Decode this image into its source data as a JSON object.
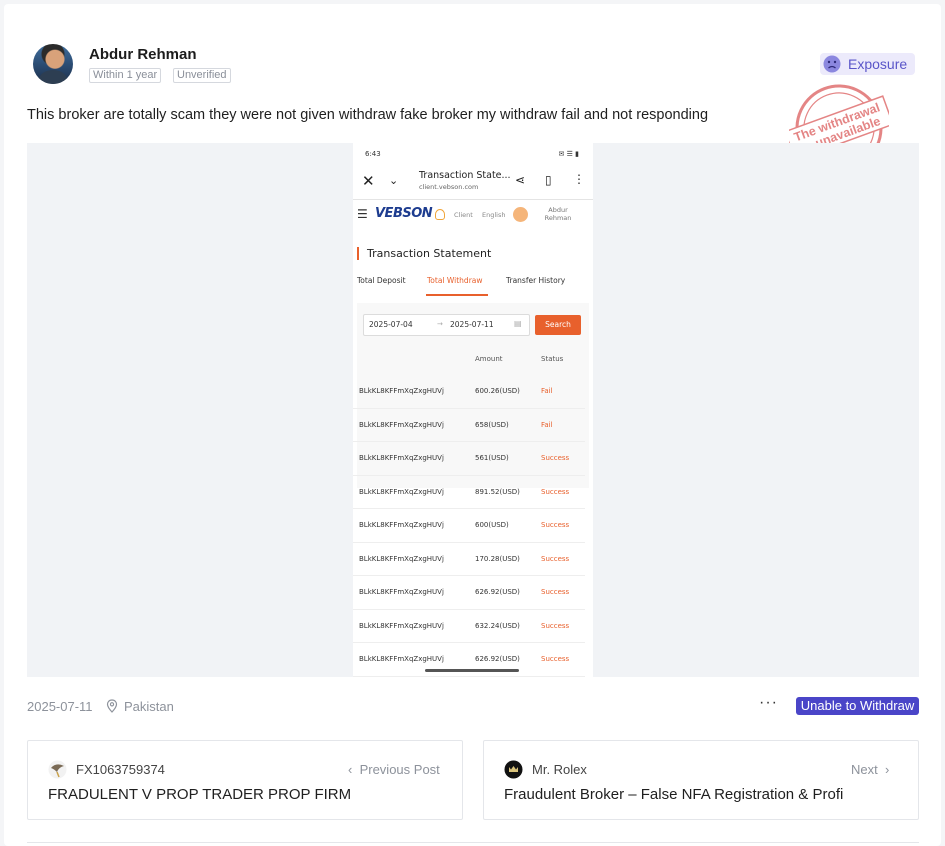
{
  "author": {
    "name": "Abdur Rehman",
    "tags": [
      "Within 1 year",
      "Unverified"
    ]
  },
  "category": {
    "label": "Exposure",
    "icon": "sad-face-icon",
    "color": "#5a56c9"
  },
  "stamp": {
    "line1": "The withdrawal",
    "line2": "is unavailable",
    "color": "#e07070"
  },
  "post": {
    "text": "This broker are totally scam they were not given withdraw fake broker my withdraw fail and not responding"
  },
  "screenshot": {
    "status_time": "6:43",
    "status_right": "✉ ☰ ▮",
    "page_title": "Transaction State...",
    "url": "client.vebson.com",
    "logo": "VEBSON",
    "nav_client": "Client",
    "nav_lang": "English",
    "nav_user_line1": "Abdur",
    "nav_user_line2": "Rehman",
    "section_title": "Transaction Statement",
    "tabs": [
      "Total Deposit",
      "Total Withdraw",
      "Transfer History"
    ],
    "active_tab": "Total Withdraw",
    "date_from": "2025-07-04",
    "date_arrow": "→",
    "date_to": "2025-07-11",
    "search_label": "Search",
    "columns": [
      "Amount",
      "Status"
    ],
    "rows": [
      {
        "id": "BLkKL8KFFmXqZxgHUVj",
        "amount": "600.26(USD)",
        "status": "Fail"
      },
      {
        "id": "BLkKL8KFFmXqZxgHUVj",
        "amount": "658(USD)",
        "status": "Fail"
      },
      {
        "id": "BLkKL8KFFmXqZxgHUVj",
        "amount": "561(USD)",
        "status": "Success"
      },
      {
        "id": "BLkKL8KFFmXqZxgHUVj",
        "amount": "891.52(USD)",
        "status": "Success"
      },
      {
        "id": "BLkKL8KFFmXqZxgHUVj",
        "amount": "600(USD)",
        "status": "Success"
      },
      {
        "id": "BLkKL8KFFmXqZxgHUVj",
        "amount": "170.28(USD)",
        "status": "Success"
      },
      {
        "id": "BLkKL8KFFmXqZxgHUVj",
        "amount": "626.92(USD)",
        "status": "Success"
      },
      {
        "id": "BLkKL8KFFmXqZxgHUVj",
        "amount": "632.24(USD)",
        "status": "Success"
      },
      {
        "id": "BLkKL8KFFmXqZxgHUVj",
        "amount": "626.92(USD)",
        "status": "Success"
      }
    ]
  },
  "meta": {
    "date": "2025-07-11",
    "location_icon": "location-pin-icon",
    "location": "Pakistan",
    "more_icon": "ellipsis-icon",
    "badge": "Unable to Withdraw",
    "badge_color": "#4a45c8"
  },
  "navigation": {
    "previous": {
      "user": "FX1063759374",
      "direction": "Previous Post",
      "title": "FRADULENT V PROP TRADER PROP FIRM"
    },
    "next": {
      "user": "Mr. Rolex",
      "direction": "Next",
      "title": "Fraudulent Broker – False NFA Registration & Profi"
    }
  }
}
